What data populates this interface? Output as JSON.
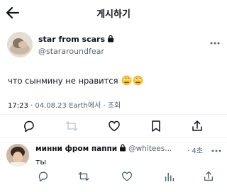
{
  "header": {
    "title": "게시하기",
    "back_icon": "back-arrow-icon"
  },
  "tweet": {
    "display_name": "star from scars",
    "handle": "@stararoundfear",
    "text": "что сынмину не нравится",
    "time": "17:23",
    "date_meta": " · 04.08.23 Earth에서 · 조회",
    "emojis": [
      "eye-roll-face-icon",
      "eye-roll-face-icon"
    ]
  },
  "actions": [
    "reply-icon",
    "retweet-icon",
    "like-icon",
    "bookmark-icon",
    "share-icon"
  ],
  "reply": {
    "display_name": "минни фром паппи",
    "handle": "@whitees...",
    "time": "· 4초",
    "text": "ты"
  },
  "reply_actions": [
    "reply-icon",
    "retweet-icon",
    "like-icon",
    "views-icon",
    "share-icon"
  ],
  "colors": {
    "text": "#0f1419",
    "secondary": "#536471",
    "divider": "#eff3f4",
    "emoji": "#f5c33b"
  }
}
